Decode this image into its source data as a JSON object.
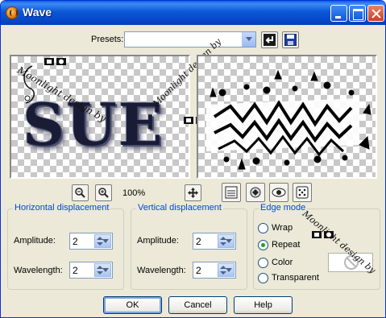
{
  "window": {
    "title": "Wave"
  },
  "presets": {
    "label": "Presets:",
    "value": ""
  },
  "preview": {
    "zoom": "100%",
    "original_text": "SUE"
  },
  "watermarks": {
    "text_1": "Moonlight design by",
    "text_2": "Sue"
  },
  "horizontal": {
    "title": "Horizontal displacement",
    "amplitude_label": "Amplitude:",
    "amplitude_value": "2",
    "wavelength_label": "Wavelength:",
    "wavelength_value": "2"
  },
  "vertical": {
    "title": "Vertical displacement",
    "amplitude_label": "Amplitude:",
    "amplitude_value": "2",
    "wavelength_label": "Wavelength:",
    "wavelength_value": "2"
  },
  "edge_mode": {
    "title": "Edge mode",
    "options": [
      "Wrap",
      "Repeat",
      "Color",
      "Transparent"
    ],
    "selected": "Repeat"
  },
  "buttons": {
    "ok": "OK",
    "cancel": "Cancel",
    "help": "Help"
  },
  "icons": {
    "app": "paint-shop-icon",
    "save_preset": "save-preset-icon",
    "reset": "reset-icon",
    "zoom_out": "zoom-out-icon",
    "zoom_in": "zoom-in-icon",
    "move": "move-icon",
    "proof": "proof-icon",
    "auto_proof": "auto-proof-icon",
    "randomize": "dice-icon"
  },
  "colors": {
    "title_bar": "#0a58d8",
    "group_title": "#0046d5",
    "dialog_bg": "#ece9d8"
  }
}
